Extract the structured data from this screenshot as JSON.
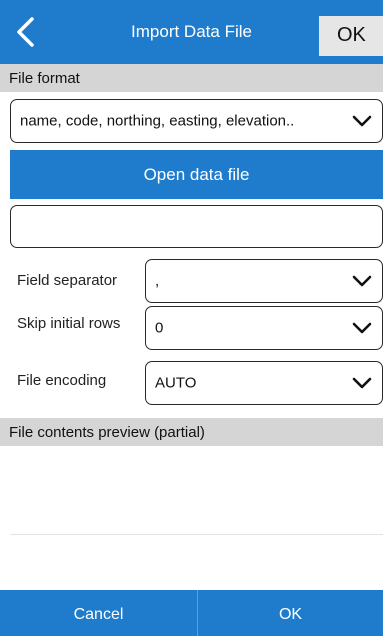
{
  "header": {
    "title": "Import Data File",
    "ok_label": "OK",
    "back_icon": "chevron-left-icon"
  },
  "file_format": {
    "section_label": "File format",
    "selected": "name, code, northing, easting, elevation.."
  },
  "open_button_label": "Open data file",
  "file_path_value": "",
  "field_separator": {
    "label": "Field separator",
    "selected": ","
  },
  "skip_rows": {
    "label": "Skip initial rows",
    "selected": "0"
  },
  "file_encoding": {
    "label": "File encoding",
    "selected": "AUTO"
  },
  "preview": {
    "section_label": "File contents preview (partial)"
  },
  "footer": {
    "cancel_label": "Cancel",
    "ok_label": "OK"
  },
  "colors": {
    "primary": "#1f7ccc",
    "section_bg": "#d5d5d5",
    "ok_chip": "#e6e6e6"
  }
}
